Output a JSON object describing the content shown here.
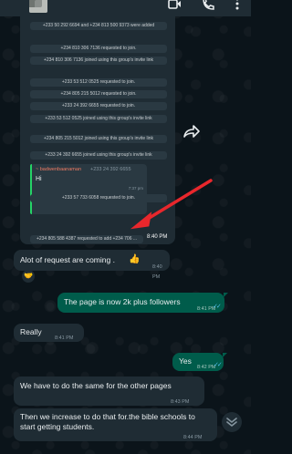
{
  "screenshot": {
    "system_messages": [
      "+233 50 292 6694 and +234 813 500 9373 were added",
      "+234 810 306 7136 requested to join.",
      "+234 810 306 7136 joined using this group's invite link",
      "+233 53 512 0525 requested to join.",
      "+234 805 215 5012 requested to join.",
      "+233 24 392 6655 requested to join.",
      "+233 53 512 0525 joined using this group's invite link",
      "+234 805 215 5012 joined using this group's invite link",
      "+233 24 392 6655 joined using this group's invite link"
    ],
    "quoted": {
      "sender": "~ badwenbaanaman",
      "phone": "+233 24 392 6655",
      "text": "Hi",
      "time": "7:37 pm"
    },
    "after_messages": [
      "+233 57 733 6058 requested to join.",
      "+234 805 588 4387 requested to add +234 706 ..."
    ],
    "time": "8:40 PM"
  },
  "messages": [
    {
      "dir": "in",
      "text": "Alot of request are coming .",
      "emoji": "👍",
      "time": "8:40 PM",
      "reaction": "🤝"
    },
    {
      "dir": "out",
      "text": "The page is now 2k plus followers",
      "time": "8:41 PM"
    },
    {
      "dir": "in",
      "text": "Really",
      "time": "8:41 PM"
    },
    {
      "dir": "out",
      "text": "Yes",
      "time": "8:42 PM"
    },
    {
      "dir": "in",
      "text": "We have to do the same for the other pages",
      "time": "8:43 PM"
    },
    {
      "dir": "in",
      "text": "Then we increase to do that for.the bible schools to start getting students.",
      "time": "8:44 PM"
    }
  ],
  "icons": {
    "header": [
      "video-call-icon",
      "phone-icon",
      "more-options-icon"
    ],
    "forward": "forward-icon",
    "scroll": "scroll-down-icon",
    "tick_color": "#53bdeb",
    "arrow_color": "#e8272c"
  }
}
